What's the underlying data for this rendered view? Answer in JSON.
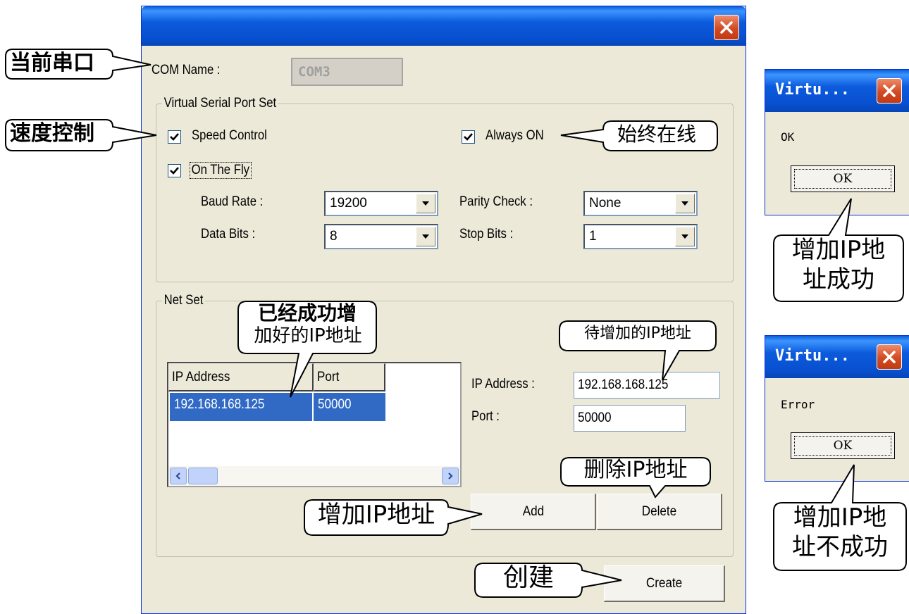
{
  "dialog": {
    "com_name_label": "COM Name :",
    "com_name_value": "COM3",
    "virtual_group_title": "Virtual Serial Port Set",
    "speed_control_label": "Speed Control",
    "speed_control_checked": true,
    "always_on_label": "Always ON",
    "always_on_checked": true,
    "on_the_fly_label": "On The Fly",
    "on_the_fly_checked": true,
    "baud_rate_label": "Baud Rate :",
    "baud_rate_value": "19200",
    "data_bits_label": "Data Bits :",
    "data_bits_value": "8",
    "parity_label": "Parity Check :",
    "parity_value": "None",
    "stop_bits_label": "Stop Bits :",
    "stop_bits_value": "1",
    "net_group_title": "Net Set",
    "list_columns": [
      "IP Address",
      "Port"
    ],
    "list_rows": [
      [
        "192.168.168.125",
        "50000"
      ]
    ],
    "ip_label": "IP Address :",
    "ip_value": "192.168.168.125",
    "port_label": "Port :",
    "port_value": "50000",
    "add_button": "Add",
    "delete_button": "Delete",
    "create_button": "Create"
  },
  "msg_success": {
    "title": "Virtu...",
    "text": "OK",
    "ok_button": "OK"
  },
  "msg_error": {
    "title": "Virtu...",
    "text": "Error",
    "ok_button": "OK"
  },
  "callouts": {
    "current_port": "当前串口",
    "speed_control": "速度控制",
    "always_online": "始终在线",
    "added_ip_line1": "已经成功增",
    "added_ip_line2": "加好的IP地址",
    "pending_ip": "待增加的IP地址",
    "delete_ip": "删除IP地址",
    "add_ip": "增加IP地址",
    "create": "创建",
    "add_success_line1": "增加IP地",
    "add_success_line2": "址成功",
    "add_fail_line1": "增加IP地",
    "add_fail_line2": "址不成功"
  },
  "colors": {
    "title_blue": "#0a5fd8",
    "selection_blue": "#316ac5",
    "dialog_face": "#ece9d8",
    "close_red": "#d24a22"
  }
}
